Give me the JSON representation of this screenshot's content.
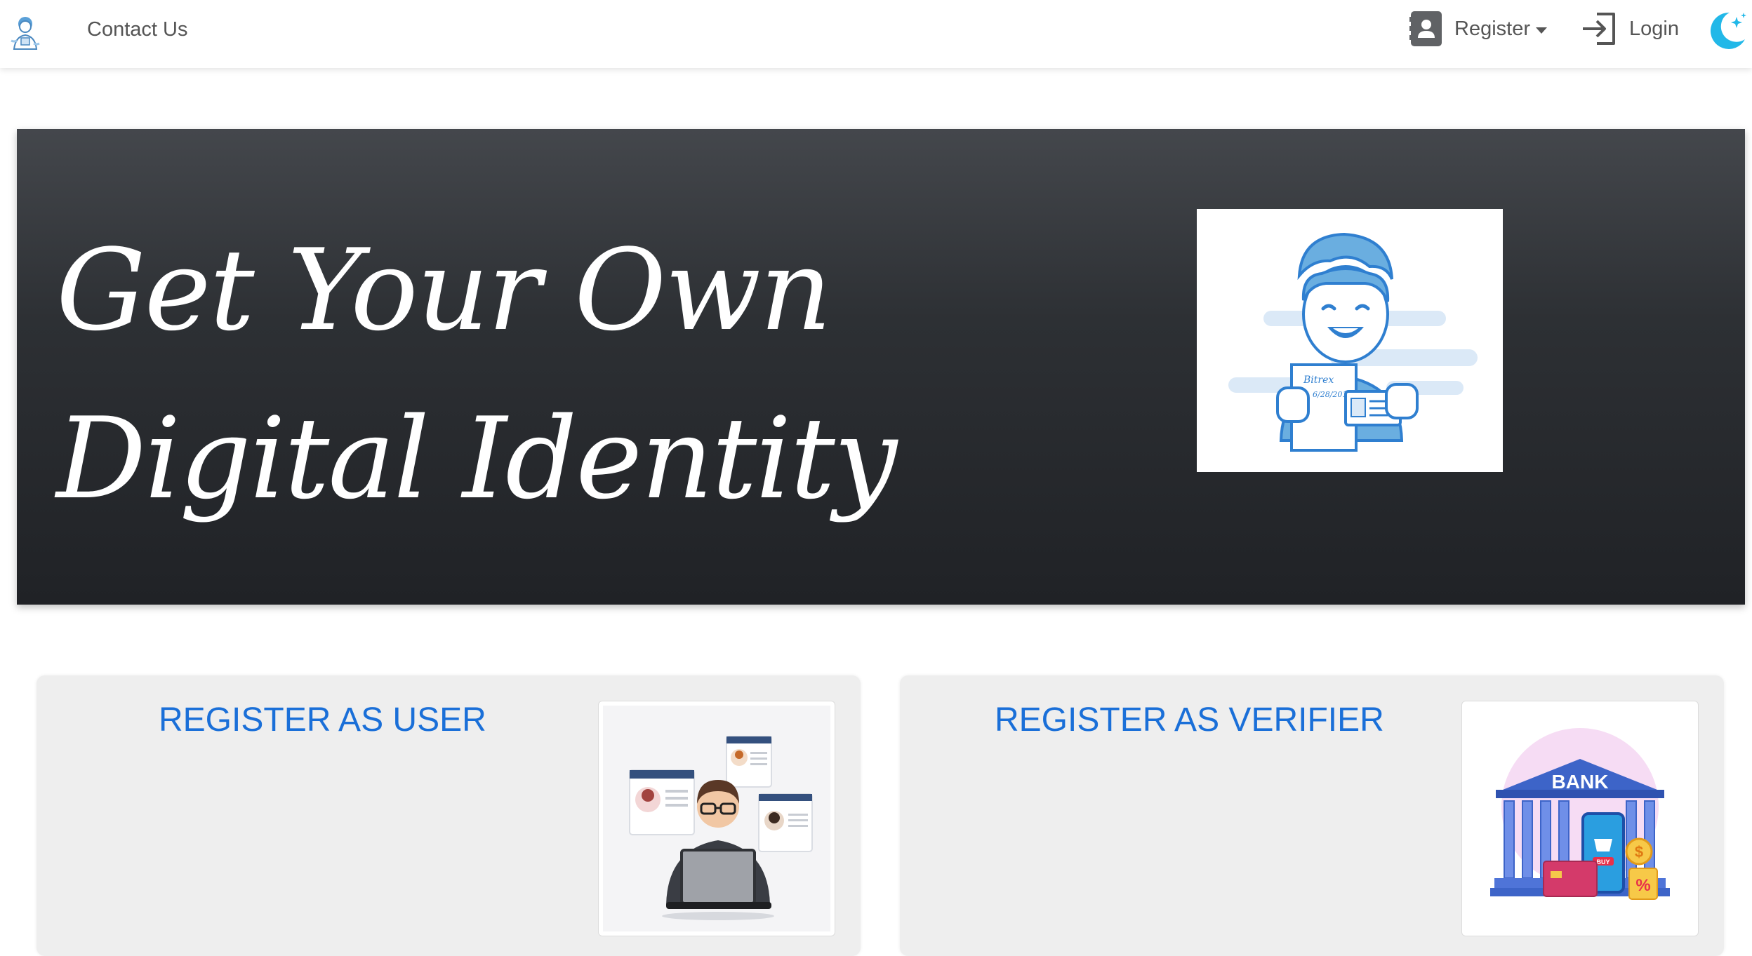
{
  "navbar": {
    "brand_logo": "avatar-logo-icon",
    "contact_label": "Contact Us",
    "register_label": "Register",
    "register_icon": "contact-card-icon",
    "login_label": "Login",
    "login_icon": "sign-in-icon",
    "theme_icon": "moon-stars-icon"
  },
  "hero": {
    "title_line1": "Get Your Own",
    "title_line2": "Digital Identity",
    "image_icon": "person-holding-id-illustration",
    "image_text_1": "Bitrex",
    "image_text_2": "6/28/2011"
  },
  "cards": {
    "user": {
      "title": "REGISTER AS USER",
      "image_icon": "user-with-laptop-illustration"
    },
    "verifier": {
      "title": "REGISTER AS VERIFIER",
      "image_icon": "bank-illustration",
      "image_text": "BANK",
      "badge_text": "BUY"
    }
  },
  "colors": {
    "accent_blue": "#1a6fd8",
    "hero_dark": "#2d3034",
    "theme_cyan": "#22b8e8"
  }
}
